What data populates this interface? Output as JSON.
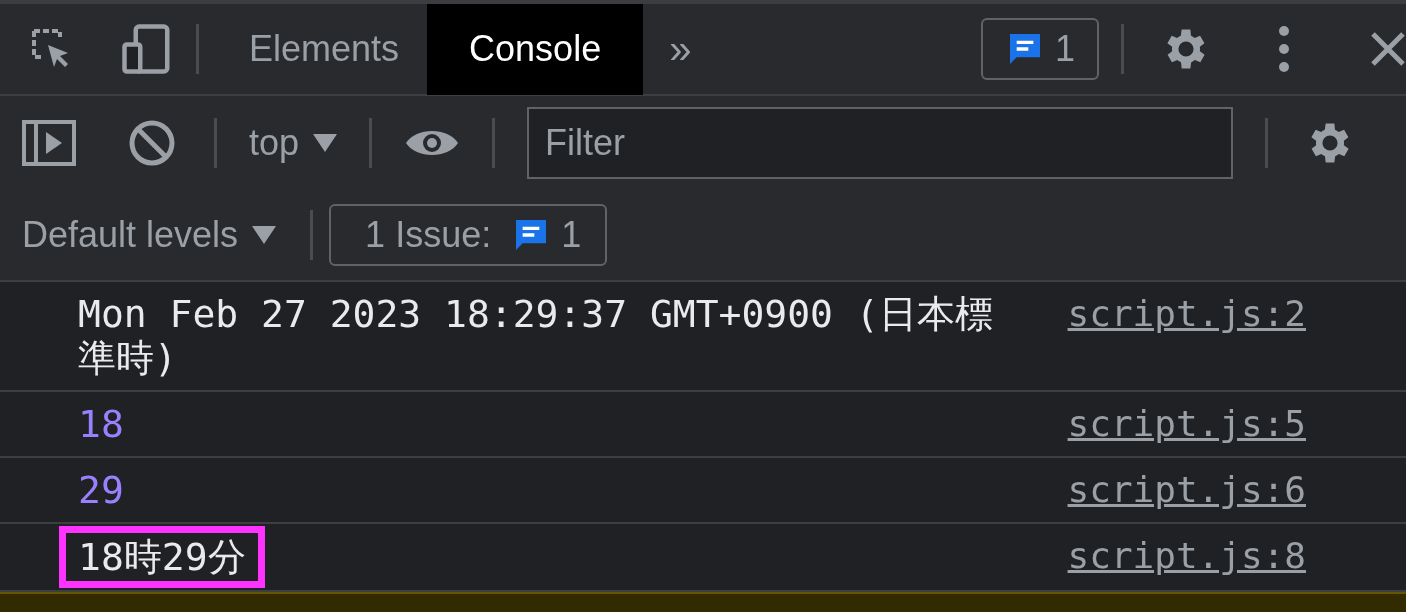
{
  "toolbar": {
    "tabs": [
      {
        "label": "Elements",
        "selected": false
      },
      {
        "label": "Console",
        "selected": true
      }
    ],
    "more": "»",
    "issues_count": "1"
  },
  "console_toolbar": {
    "context": "top",
    "filter": {
      "placeholder": "Filter"
    }
  },
  "levels_bar": {
    "levels": "Default levels",
    "issues_label": "1 Issue:",
    "issues_count": "1"
  },
  "messages": [
    {
      "kind": "text",
      "text": "Mon Feb 27 2023 18:29:37 GMT+0900 (日本標準時)",
      "source": "script.js:2",
      "highlighted": false
    },
    {
      "kind": "number",
      "text": "18",
      "source": "script.js:5",
      "highlighted": false
    },
    {
      "kind": "number",
      "text": "29",
      "source": "script.js:6",
      "highlighted": false
    },
    {
      "kind": "text",
      "text": "18時29分",
      "source": "script.js:8",
      "highlighted": true
    }
  ]
}
